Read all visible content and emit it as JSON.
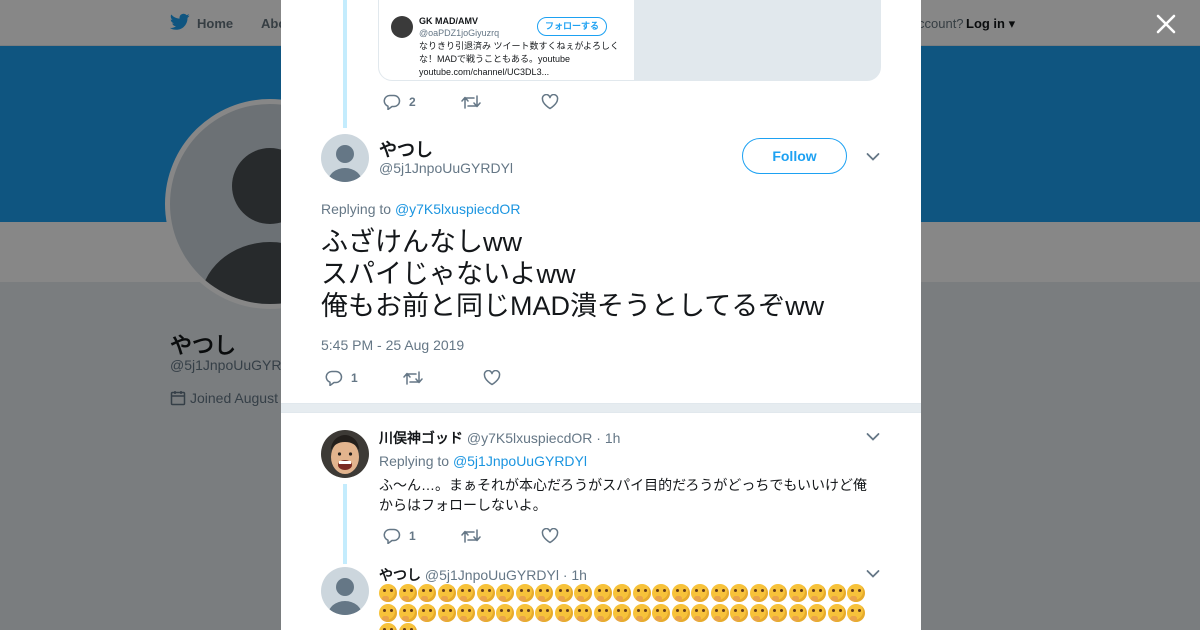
{
  "colors": {
    "accent": "#1da1f2",
    "link": "#1b95e0",
    "muted": "#657786",
    "thread": "#c4ecfd",
    "emoji": "#f7c23a"
  },
  "background_page": {
    "nav": {
      "home": "Home",
      "about": "Abo",
      "account_prompt": "ccount?",
      "login": "Log in"
    },
    "profile": {
      "name": "やつし",
      "handle": "@5j1JnpoUuGYR",
      "joined": "Joined August"
    }
  },
  "quoted_card": {
    "name": "GK MAD/AMV",
    "handle": "@oaPDZ1joGiyuzrq",
    "follow": "フォローする",
    "bio": "なりきり引退済み ツイート数すくねぇがよろしくな！MADで戦うこともある。youtube youtube.com/channel/UC3DL3..."
  },
  "parent_tweet_actions": {
    "replies": "2",
    "retweets": "",
    "likes": ""
  },
  "main_tweet": {
    "name": "やつし",
    "handle": "@5j1JnpoUuGYRDYl",
    "follow_label": "Follow",
    "replying_prefix": "Replying to",
    "replying_to": "@y7K5lxuspiecdOR",
    "text": "ふざけんなしww\nスパイじゃないよww\n俺もお前と同じMAD潰そうとしてるぞww",
    "timestamp": "5:45 PM - 25 Aug 2019",
    "actions": {
      "replies": "1",
      "retweets": "",
      "likes": ""
    }
  },
  "replies": [
    {
      "name": "川俣神ゴッド",
      "handle": "@y7K5lxuspiecdOR",
      "time": "· 1h",
      "replying_prefix": "Replying to",
      "replying_to": "@5j1JnpoUuGYRDYl",
      "text": "ふ〜ん…。まぁそれが本心だろうがスパイ目的だろうがどっちでもいいけど俺からはフォローしないよ。",
      "actions": {
        "replies": "1",
        "retweets": "",
        "likes": ""
      }
    },
    {
      "name": "やつし",
      "handle": "@5j1JnpoUuGYRDYl",
      "time": "· 1h",
      "emoji_name": "thinking-face",
      "emoji_count": 52
    }
  ]
}
